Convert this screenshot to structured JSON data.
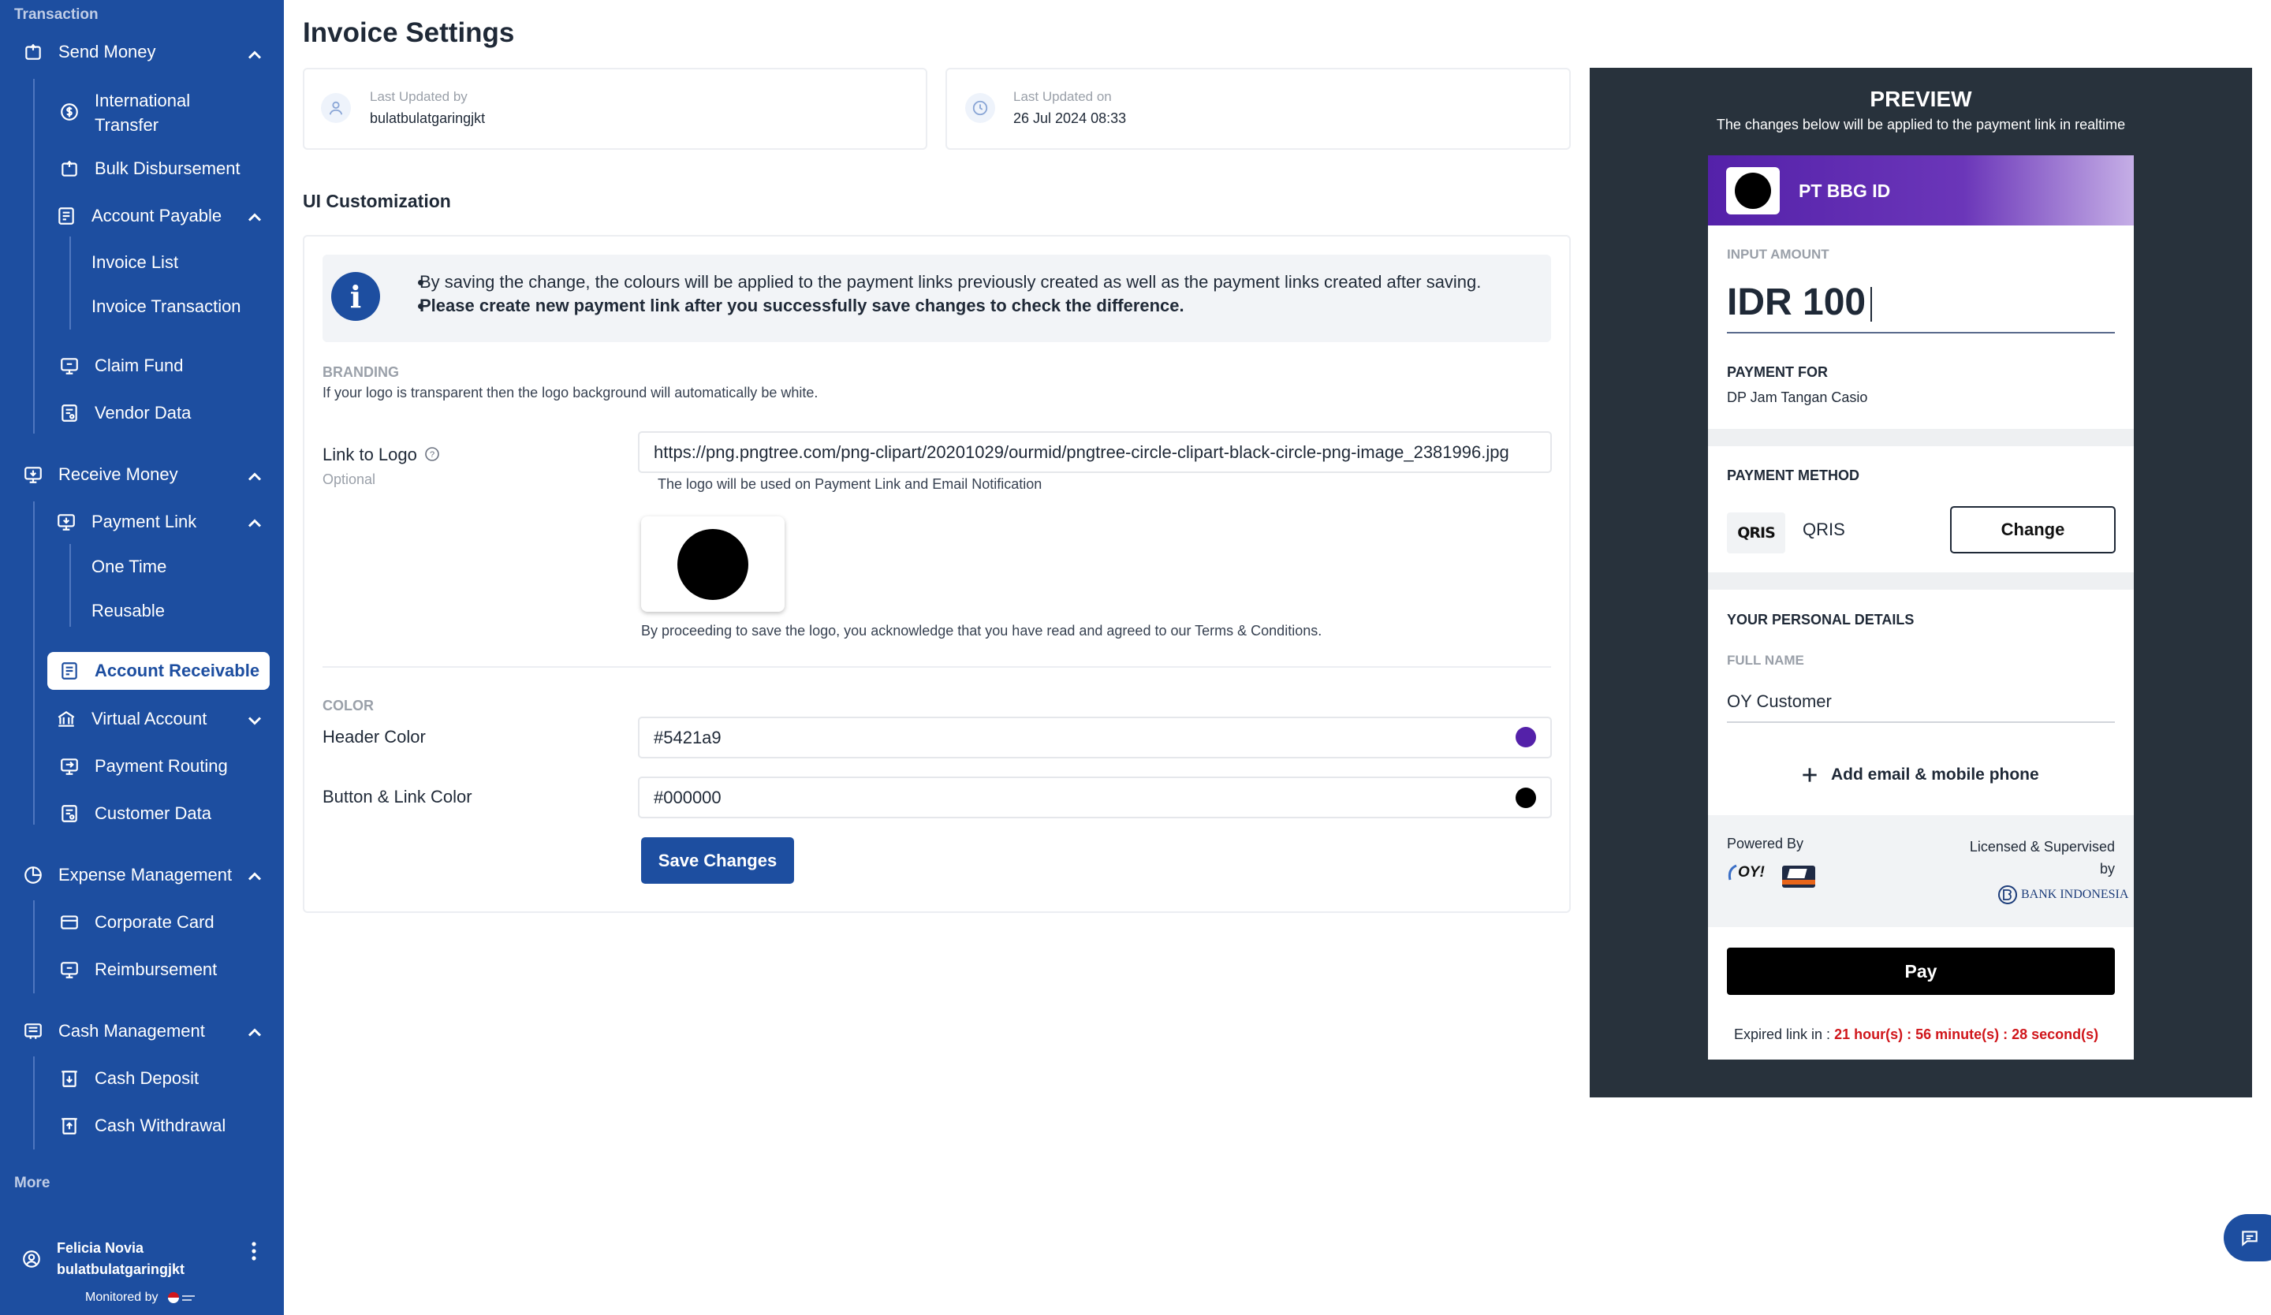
{
  "sidebar": {
    "section_transaction": "Transaction",
    "section_more": "More",
    "send_money": "Send Money",
    "international_transfer_1": "International",
    "international_transfer_2": "Transfer",
    "bulk_disbursement": "Bulk Disbursement",
    "account_payable": "Account Payable",
    "invoice_list": "Invoice List",
    "invoice_transaction": "Invoice Transaction",
    "claim_fund": "Claim Fund",
    "vendor_data": "Vendor Data",
    "receive_money": "Receive Money",
    "payment_link": "Payment Link",
    "one_time": "One Time",
    "reusable": "Reusable",
    "account_receivable": "Account Receivable",
    "virtual_account": "Virtual Account",
    "payment_routing": "Payment Routing",
    "customer_data": "Customer Data",
    "expense_management": "Expense Management",
    "corporate_card": "Corporate Card",
    "reimbursement": "Reimbursement",
    "cash_management": "Cash Management",
    "cash_deposit": "Cash Deposit",
    "cash_withdrawal": "Cash Withdrawal",
    "user_name": "Felicia Novia",
    "user_handle": "bulatbulatgaringjkt",
    "monitored_by": "Monitored by"
  },
  "page": {
    "title": "Invoice Settings",
    "last_updated_by_label": "Last Updated by",
    "last_updated_by_value": "bulatbulatgaringjkt",
    "last_updated_on_label": "Last Updated on",
    "last_updated_on_value": "26 Jul 2024 08:33",
    "ui_customization": "UI Customization",
    "info_line1": "By saving the change, the colours will be applied to the payment links previously created as well as the payment links created after saving.",
    "info_line2": "Please create new payment link after you successfully save changes to check the difference.",
    "branding_label": "BRANDING",
    "branding_desc": "If your logo is transparent then the logo background will automatically be white.",
    "link_to_logo_label": "Link to Logo",
    "optional": "Optional",
    "logo_url": "https://png.pngtree.com/png-clipart/20201029/ourmid/pngtree-circle-clipart-black-circle-png-image_2381996.jpg",
    "logo_hint": "The logo will be used on Payment Link and Email Notification",
    "logo_ack": "By proceeding to save the logo, you acknowledge that you have read and agreed to our Terms & Conditions.",
    "color_label": "COLOR",
    "header_color_label": "Header Color",
    "header_color_value": "#5421a9",
    "button_color_label": "Button & Link Color",
    "button_color_value": "#000000",
    "save_button": "Save Changes"
  },
  "preview": {
    "title": "PREVIEW",
    "subtitle": "The changes below will be applied to the payment link in realtime",
    "company": "PT BBG ID",
    "input_amount_label": "INPUT AMOUNT",
    "amount": "IDR 100",
    "payment_for_label": "PAYMENT FOR",
    "payment_for_value": "DP Jam Tangan Casio",
    "payment_method_label": "PAYMENT METHOD",
    "method_logo": "QRIS",
    "method_name": "QRIS",
    "change_button": "Change",
    "personal_details_label": "YOUR PERSONAL DETAILS",
    "full_name_label": "FULL NAME",
    "full_name_value": "OY Customer",
    "add_contact": "Add email & mobile phone",
    "powered_by": "Powered By",
    "powered_logo": "OY!",
    "licensed_line1": "Licensed & Supervised",
    "licensed_line2": "by",
    "bank_name": "BANK INDONESIA",
    "pay_button": "Pay",
    "expired_label": "Expired link in :",
    "expired_value": "21 hour(s) : 56 minute(s) : 28 second(s)"
  },
  "colors": {
    "sidebar": "#1d4ea0",
    "header": "#5421a9",
    "button": "#000000",
    "expired": "#d0161b"
  }
}
